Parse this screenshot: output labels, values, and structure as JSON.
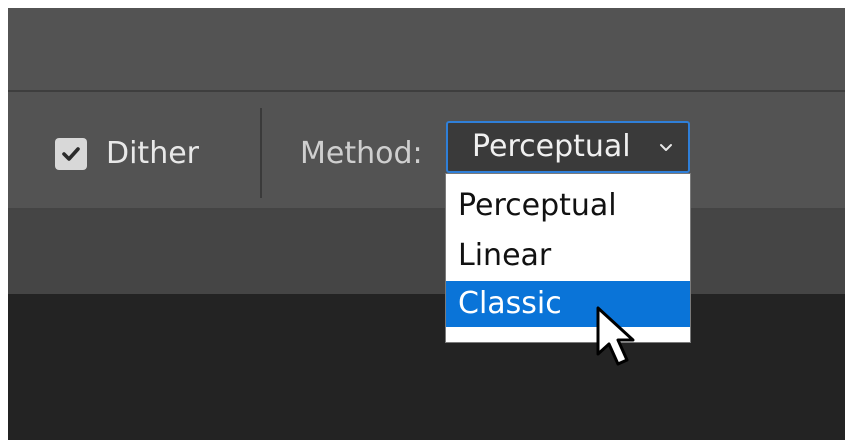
{
  "options_bar": {
    "dither": {
      "label": "Dither",
      "checked": true
    },
    "method": {
      "label": "Method:",
      "selected": "Perceptual",
      "options": [
        "Perceptual",
        "Linear",
        "Classic"
      ],
      "highlighted_option": "Classic"
    }
  },
  "icons": {
    "checkbox": "checkmark-icon",
    "dropdown": "chevron-down-icon",
    "pointer": "mouse-cursor-icon"
  },
  "colors": {
    "toolbar_bg": "#535353",
    "panel_bg": "#454545",
    "canvas_bg": "#232323",
    "select_border": "#2f7fd8",
    "highlight": "#0a74d8"
  }
}
